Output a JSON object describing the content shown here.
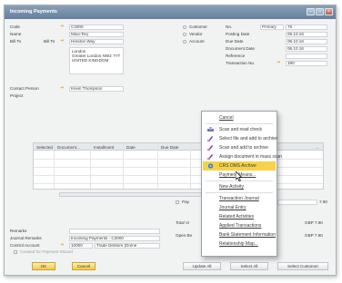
{
  "window": {
    "title": "Incoming Payments"
  },
  "header_left": {
    "code_label": "Code",
    "code_value": "C2000",
    "name_label": "Name",
    "name_value": "Maxi-Teq",
    "billto_label": "Bill To",
    "billto_code": "Bill To",
    "address_lines": [
      "Hendon Way",
      "London",
      "Greater London NW2 7YT",
      "UNITED KINGDOM"
    ],
    "contact_label": "Contact Person",
    "contact_value": "Kevin Thompson",
    "project_label": "Project"
  },
  "header_mid": {
    "options": [
      "Customer",
      "Vendor",
      "Account"
    ]
  },
  "header_right": {
    "no_label": "No.",
    "no_series": "Primary",
    "no_value": "76",
    "posting_label": "Posting Date",
    "posting_value": "06.10.16",
    "due_label": "Due Date",
    "due_value": "06.10.16",
    "docdate_label": "Document Date",
    "docdate_value": "06.10.16",
    "reference_label": "Reference",
    "transno_label": "Transaction No.",
    "transno_value": "190"
  },
  "grid": {
    "columns": [
      "Selected",
      "Document...",
      "Installment",
      "Date",
      "Due Date",
      "..."
    ]
  },
  "footer": {
    "remarks_label": "Remarks",
    "journal_label": "Journal Remarks",
    "journal_value": "Incoming Payments - C2000",
    "control_label": "Control Account",
    "control_code": "10000",
    "control_name": "Trade Debtors (Dome",
    "created_label": "Created for Payment Wizard",
    "ok_label": "OK",
    "cancel_label": "Cancel",
    "total_label": "Total Vi",
    "total_value": "GBP 7.90",
    "open_label": "Open Be",
    "open_value": "GBP 7.90",
    "right_amount": "7.90",
    "pay_label": "Pay",
    "btn1": "Update All",
    "btn2": "Select All",
    "btn3": "Select Customer"
  },
  "context_menu": {
    "items": [
      "Cancel",
      "Scan and read check",
      "Select file and add to archive",
      "Scan and add to archive",
      "Assign document in mass scan",
      "CRS DMS Archive",
      "Payment Means...",
      "New Activity",
      "Transaction Journal",
      "Journal Entry",
      "Related Activities",
      "Applied Transactions",
      "Bank Statement Information",
      "Relationship Map..."
    ],
    "highlighted_index": 5
  },
  "colors": {
    "titlebar": "#63809e",
    "highlight": "#f5d24a",
    "field_yellow": "#fff6bf",
    "link_arrow": "#e2a21c"
  }
}
